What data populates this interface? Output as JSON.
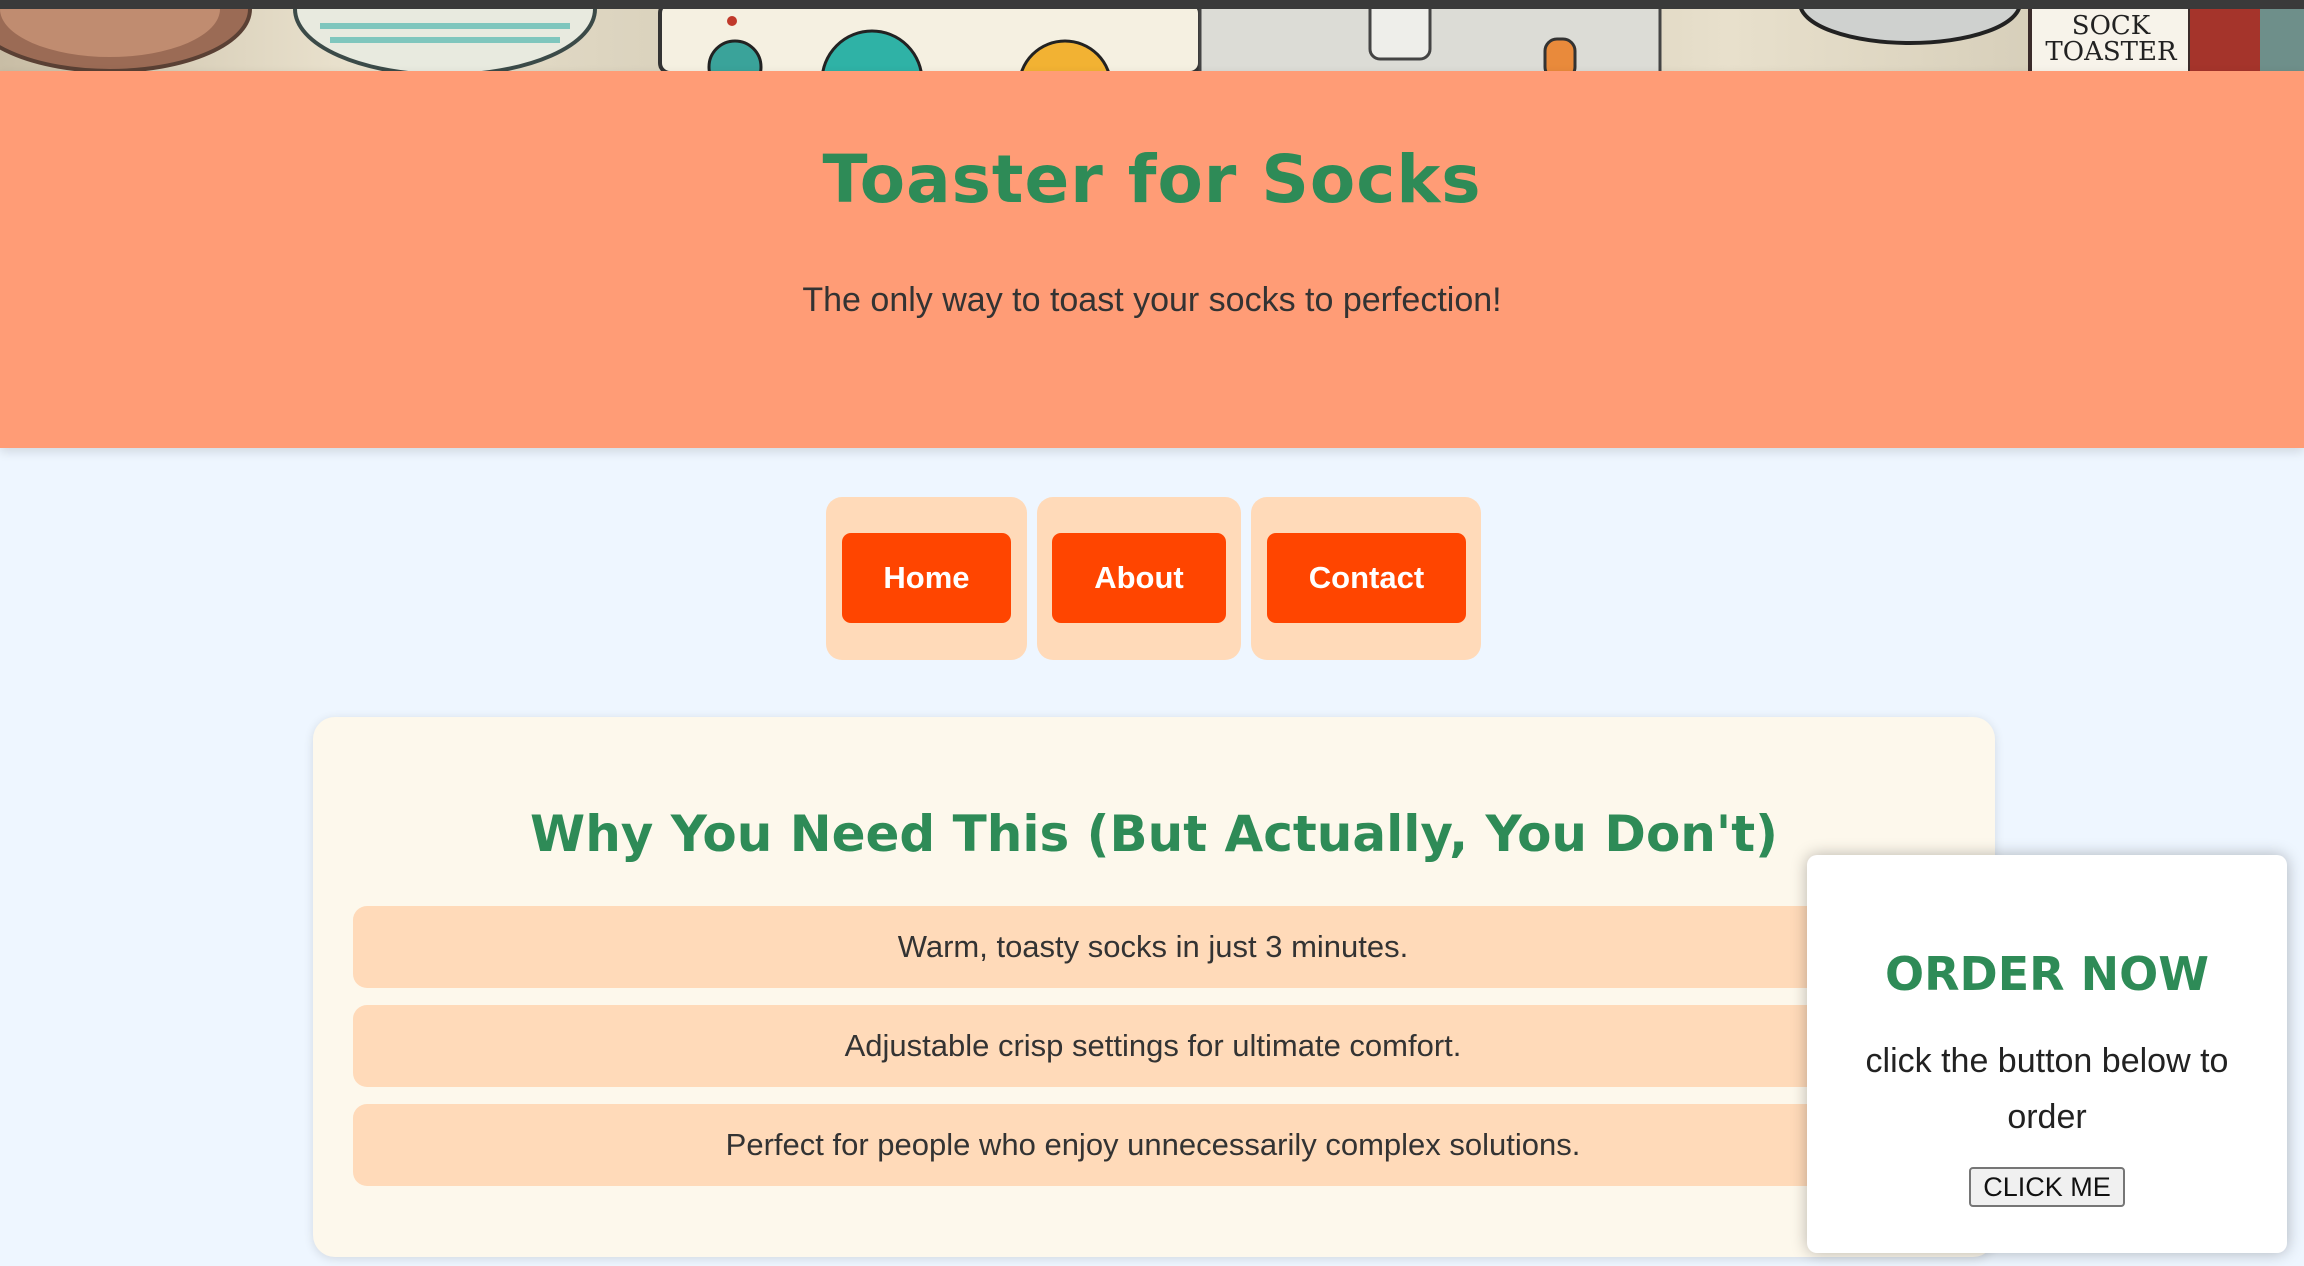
{
  "banner": {
    "box_label": "SOCK TOASTER"
  },
  "hero": {
    "title": "Toaster for Socks",
    "subtitle": "The only way to toast your socks to perfection!"
  },
  "nav": {
    "items": [
      {
        "label": "Home"
      },
      {
        "label": "About"
      },
      {
        "label": "Contact"
      }
    ]
  },
  "features": {
    "title": "Why You Need This (But Actually, You Don't)",
    "items": [
      "Warm, toasty socks in just 3 minutes.",
      "Adjustable crisp settings for ultimate comfort.",
      "Perfect for people who enjoy unnecessarily complex solutions."
    ]
  },
  "popup": {
    "title": "ORDER NOW",
    "text": "click the button below to order",
    "button_label": "CLICK ME"
  },
  "colors": {
    "hero_bg": "#ff9c76",
    "accent_green": "#2e8b57",
    "button_orange": "#ff4500",
    "tile_peach": "#ffdab9",
    "page_bg": "#eef6ff"
  }
}
